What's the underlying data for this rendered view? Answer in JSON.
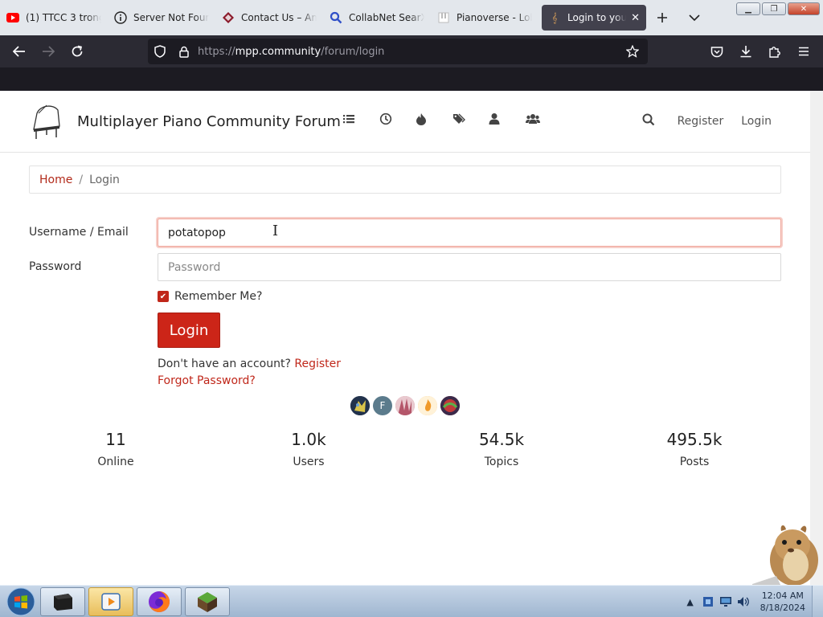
{
  "browser": {
    "tabs": [
      {
        "title": "(1) TTCC 3 trong",
        "icon": "youtube-icon"
      },
      {
        "title": "Server Not Found",
        "icon": "info-icon"
      },
      {
        "title": "Contact Us – Am",
        "icon": "site-icon"
      },
      {
        "title": "CollabNet SearX",
        "icon": "search-icon"
      },
      {
        "title": "Pianoverse - Lob",
        "icon": "piano-icon"
      },
      {
        "title": "Login to your",
        "icon": "music-icon",
        "active": true
      }
    ],
    "url_prefix": "https://",
    "url_host": "mpp.community",
    "url_path": "/forum/login"
  },
  "site": {
    "title": "Multiplayer Piano Community Forum",
    "nav_register": "Register",
    "nav_login": "Login",
    "accent": "#cc2518"
  },
  "breadcrumb": {
    "home": "Home",
    "separator": "/",
    "current": "Login"
  },
  "form": {
    "username_label": "Username / Email",
    "username_value": "potatopop",
    "password_label": "Password",
    "password_placeholder": "Password",
    "remember_label": "Remember Me?",
    "remember_checked": true,
    "login_button": "Login",
    "no_account_text": "Don't have an account?",
    "register_link": "Register",
    "forgot_link": "Forgot Password?"
  },
  "avatars": [
    {
      "letter": "",
      "color": "#2a3a55"
    },
    {
      "letter": "F",
      "color": "#5b7b8c"
    },
    {
      "letter": "",
      "color": "#c77a8a"
    },
    {
      "letter": "",
      "color": "#f2b04a"
    },
    {
      "letter": "",
      "color": "#8a2a3a"
    }
  ],
  "stats": [
    {
      "value": "11",
      "label": "Online"
    },
    {
      "value": "1.0k",
      "label": "Users"
    },
    {
      "value": "54.5k",
      "label": "Topics"
    },
    {
      "value": "495.5k",
      "label": "Posts"
    }
  ],
  "taskbar": {
    "time": "12:04 AM",
    "date": "8/18/2024"
  }
}
